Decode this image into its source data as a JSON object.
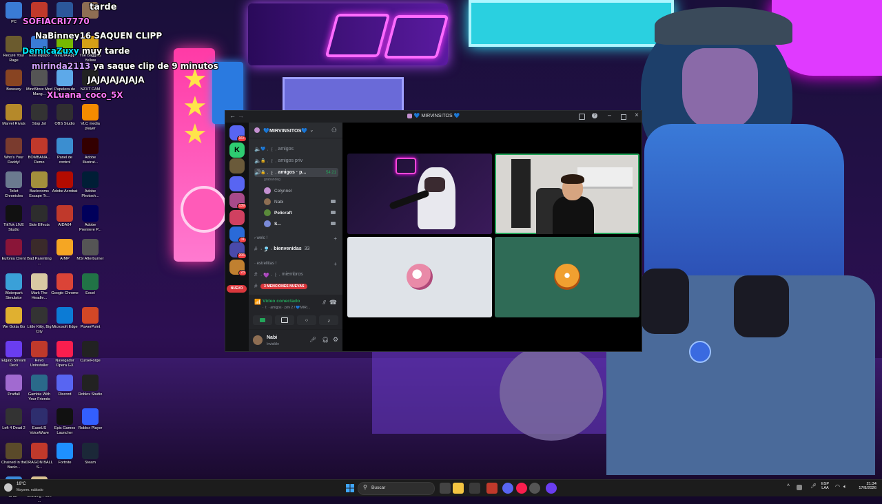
{
  "desktop": {
    "icons": [
      {
        "label": "PC",
        "icon": "monitor-icon",
        "color": "#3a7bd5"
      },
      {
        "label": "Pro",
        "icon": "app-icon",
        "color": "#c0392b"
      },
      {
        "label": "",
        "icon": "word-icon",
        "color": "#2b579a"
      },
      {
        "label": "",
        "icon": "avatar-icon",
        "color": "#8e6e53"
      },
      {
        "label": "Recuré Your Rage",
        "icon": "app-icon",
        "color": "#6b5b2e"
      },
      {
        "label": "Este equipo",
        "icon": "monitor-icon",
        "color": "#3a7bd5"
      },
      {
        "label": "NVIDIA App",
        "icon": "nvidia-icon",
        "color": "#76b900"
      },
      {
        "label": "The Baggies Yellow",
        "icon": "app-icon",
        "color": "#d4a017"
      },
      {
        "label": "Bowsery",
        "icon": "app-icon",
        "color": "#884422"
      },
      {
        "label": "MindStore Mod Mang...",
        "icon": "app-icon",
        "color": "#555"
      },
      {
        "label": "Papelera de reciclaje",
        "icon": "recycle-bin-icon",
        "color": "#5da9e9"
      },
      {
        "label": "NZXT CAM",
        "icon": "nzxt-icon",
        "color": "#222"
      },
      {
        "label": "Marvel Rivals",
        "icon": "app-icon",
        "color": "#b5892a"
      },
      {
        "label": "Stop Ja!",
        "icon": "app-icon",
        "color": "#333"
      },
      {
        "label": "OBS Studio",
        "icon": "obs-icon",
        "color": "#302e31"
      },
      {
        "label": "VLC media player",
        "icon": "vlc-icon",
        "color": "#f48b00"
      },
      {
        "label": "Who's Your Daddy!",
        "icon": "app-icon",
        "color": "#7a3b2e"
      },
      {
        "label": "BOMBANA... Demo",
        "icon": "app-icon",
        "color": "#c0392b"
      },
      {
        "label": "Panel de control",
        "icon": "control-panel-icon",
        "color": "#3b8ed0"
      },
      {
        "label": "Adobe Illustrat...",
        "icon": "illustrator-icon",
        "color": "#330000"
      },
      {
        "label": "Toilet Chronicles",
        "icon": "app-icon",
        "color": "#6b7a8f"
      },
      {
        "label": "Backrooms Escape Tr...",
        "icon": "app-icon",
        "color": "#a38f3c"
      },
      {
        "label": "Adobe Acrobat",
        "icon": "acrobat-icon",
        "color": "#b30b00"
      },
      {
        "label": "Adobe Photosh...",
        "icon": "photoshop-icon",
        "color": "#001e36"
      },
      {
        "label": "TikTok LIVE Studio",
        "icon": "tiktok-icon",
        "color": "#111"
      },
      {
        "label": "Side Effects",
        "icon": "app-icon",
        "color": "#2d2d2d"
      },
      {
        "label": "AIDA64",
        "icon": "aida-icon",
        "color": "#c0392b"
      },
      {
        "label": "Adobe Premiere P...",
        "icon": "premiere-icon",
        "color": "#00005b"
      },
      {
        "label": "Eufonia Client",
        "icon": "app-icon",
        "color": "#8a1538"
      },
      {
        "label": "Bad Parenting ...",
        "icon": "app-icon",
        "color": "#3a2a2a"
      },
      {
        "label": "AIMP",
        "icon": "aimp-icon",
        "color": "#f5a623"
      },
      {
        "label": "MSI Afterburner",
        "icon": "msi-icon",
        "color": "#555"
      },
      {
        "label": "Waterpark Simulator",
        "icon": "app-icon",
        "color": "#3aa0d8"
      },
      {
        "label": "Mark The Headle...",
        "icon": "app-icon",
        "color": "#d9c9a3"
      },
      {
        "label": "Google Chrome",
        "icon": "chrome-icon",
        "color": "#db4437"
      },
      {
        "label": "Excel",
        "icon": "excel-icon",
        "color": "#217346"
      },
      {
        "label": "We Gotta Go",
        "icon": "app-icon",
        "color": "#e0b030"
      },
      {
        "label": "Little Kitty, Big City",
        "icon": "app-icon",
        "color": "#333"
      },
      {
        "label": "Microsoft Edge",
        "icon": "edge-icon",
        "color": "#0c7bd5"
      },
      {
        "label": "PowerPoint",
        "icon": "powerpoint-icon",
        "color": "#d24726"
      },
      {
        "label": "Elgato Stream Deck",
        "icon": "elgato-icon",
        "color": "#6a3df0"
      },
      {
        "label": "Revo Uninstaller",
        "icon": "app-icon",
        "color": "#c0392b"
      },
      {
        "label": "Navegador Opera GX",
        "icon": "opera-gx-icon",
        "color": "#fa1e4e"
      },
      {
        "label": "CurseForge",
        "icon": "curseforge-icon",
        "color": "#222"
      },
      {
        "label": "Pratfall",
        "icon": "app-icon",
        "color": "#a16ad0"
      },
      {
        "label": "Gamble With Your Friends",
        "icon": "app-icon",
        "color": "#2a6a8a"
      },
      {
        "label": "Discord",
        "icon": "discord-icon",
        "color": "#5865f2"
      },
      {
        "label": "Roblox Studio",
        "icon": "roblox-icon",
        "color": "#222"
      },
      {
        "label": "Left 4 Dead 2",
        "icon": "app-icon",
        "color": "#333"
      },
      {
        "label": "EaseUS VoiceWave",
        "icon": "app-icon",
        "color": "#2e2e6e"
      },
      {
        "label": "Epic Games Launcher",
        "icon": "epic-icon",
        "color": "#111"
      },
      {
        "label": "Roblox Player",
        "icon": "roblox-icon",
        "color": "#335fff"
      },
      {
        "label": "Chained in the Backr...",
        "icon": "app-icon",
        "color": "#5a4a2a"
      },
      {
        "label": "DRAGON BALL S...",
        "icon": "app-icon",
        "color": "#c0392b"
      },
      {
        "label": "Fortnite",
        "icon": "fortnite-icon",
        "color": "#1e90ff"
      },
      {
        "label": "Steam",
        "icon": "steam-icon",
        "color": "#1b2838"
      },
      {
        "label": "SADP",
        "icon": "app-icon",
        "color": "#3a8ad8"
      },
      {
        "label": "Drawing From ...",
        "icon": "app-icon",
        "color": "#d8c090"
      }
    ]
  },
  "stream_chat": [
    {
      "user": "SOFIACRI7770",
      "text": "",
      "color": "#ff77ff"
    },
    {
      "user": "NaBinney16",
      "text": "SAQUEN CLIPP",
      "color": "#ffffff"
    },
    {
      "user": "DemicaZuxy",
      "text": "muy tarde",
      "color": "#00e5ff"
    },
    {
      "user": "mirinda2113",
      "text": "ya saque clip de 9 minutos",
      "color": "#d0a0ff"
    },
    {
      "user": "",
      "text": "JAJAJAJAJAJA",
      "color": "#ffffff"
    },
    {
      "user": "XLuana_coco_5X",
      "text": "",
      "color": "#ff77ff"
    },
    {
      "user": "",
      "text": "tarde",
      "color": "#ffffff"
    }
  ],
  "discord": {
    "window_title": "💙 MIRVINSITOS 💙",
    "server_name": "💙MIRVINSITOS💙",
    "servers": [
      {
        "badge": "16+",
        "color": "#5865f2"
      },
      {
        "badge": "",
        "color": "#2ecc71",
        "letter": "K"
      },
      {
        "badge": "",
        "color": "#6a5a3a"
      },
      {
        "badge": "",
        "color": "#5865f2"
      },
      {
        "badge": "139",
        "color": "#a84a8a"
      },
      {
        "badge": "",
        "color": "#d04060"
      },
      {
        "badge": "31",
        "color": "#2a6ad8"
      },
      {
        "badge": "206",
        "color": "#4a4aaa"
      },
      {
        "badge": "23",
        "color": "#c08030"
      }
    ],
    "new_label": "NUEVO",
    "channels": [
      {
        "icon": "speaker-icon",
        "emoji": "💙",
        "name": "amigos",
        "prefix": "· ꒰ ·"
      },
      {
        "icon": "speaker-icon",
        "emoji": "🔒",
        "name": "amigos  priv",
        "prefix": "· ꒰ ·"
      },
      {
        "icon": "speaker-icon",
        "emoji": "🔒",
        "name": "amigos · p...",
        "prefix": "· ꒰ ·",
        "timer": "54:21"
      }
    ],
    "voice_sub": "grabandeg",
    "voice_users": [
      {
        "name": "Celynnel",
        "color": "#c490d1"
      },
      {
        "name": "Nabi",
        "color": "#8e6e53"
      },
      {
        "name": "Pelicraft",
        "color": "#5a8a3a"
      },
      {
        "name": "S...",
        "color": "#7a8ad8"
      }
    ],
    "categories": [
      {
        "name": "welc !",
        "channels": [
          {
            "name": "bienvenidas",
            "prefix": "· 🎐 ·",
            "suffix": "33"
          }
        ]
      },
      {
        "name": "estrellitas !",
        "channels": [
          {
            "name": "miembros",
            "prefix": "· 💜 · ꒰ ·"
          }
        ]
      }
    ],
    "mentions_label": "3 MENCIONES NUEVAS",
    "voice_panel": {
      "status": "Video conectado",
      "location": "· ꒰ · amigos · priv 2 / 💙MIRI..."
    },
    "user": {
      "name": "Nabi",
      "status": "Invisible"
    },
    "tiles": [
      {
        "kind": "video",
        "who": "streamer-left",
        "bg": "#1a1030"
      },
      {
        "kind": "video",
        "who": "streamer-right",
        "bg": "#d8d6d2"
      },
      {
        "kind": "avatar",
        "bg": "#dfe3e8",
        "avatar_color": "#e98aa8"
      },
      {
        "kind": "avatar",
        "bg": "#2f6b56",
        "avatar_color": "#f0a030"
      }
    ]
  },
  "taskbar": {
    "weather": {
      "temp": "16°C",
      "desc": "Mayorm. nublado"
    },
    "search_placeholder": "Buscar",
    "lang": {
      "code": "ESP",
      "layout": "LAA"
    },
    "time": "21:34",
    "date": "17/8/2026"
  }
}
